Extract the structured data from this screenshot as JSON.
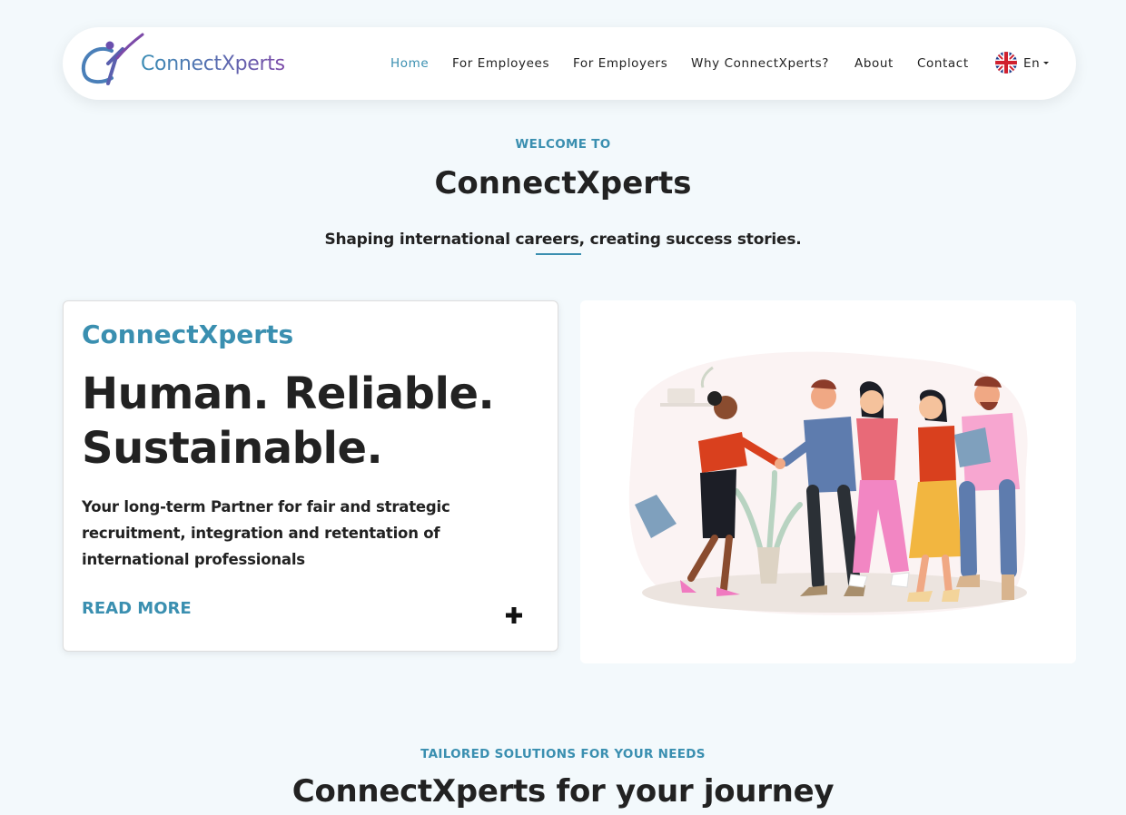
{
  "brand": {
    "name": "ConnectXperts",
    "color_primary": "#3a8fb0",
    "color_secondary": "#7c4aa8"
  },
  "nav": {
    "items": [
      {
        "label": "Home",
        "active": true
      },
      {
        "label": "For Employees",
        "active": false
      },
      {
        "label": "For Employers",
        "active": false
      },
      {
        "label": "Why ConnectXperts?",
        "active": false
      },
      {
        "label": "About",
        "active": false
      },
      {
        "label": "Contact",
        "active": false
      }
    ],
    "language": {
      "label": "En",
      "icon": "uk-flag-icon"
    }
  },
  "hero": {
    "eyebrow": "WELCOME TO",
    "title": "ConnectXperts",
    "tagline": "Shaping international careers, creating success stories."
  },
  "card": {
    "brand": "ConnectXperts",
    "headline_line1": "Human. Reliable.",
    "headline_line2": "Sustainable.",
    "description": "Your long-term Partner for fair and strategic recruitment, integration and retentation of international professionals",
    "read_more": "READ MORE",
    "expand_icon": "plus-icon"
  },
  "illustration": {
    "icon": "team-handshake-illustration"
  },
  "solutions": {
    "eyebrow": "TAILORED SOLUTIONS FOR YOUR NEEDS",
    "title": "ConnectXperts for your journey"
  }
}
